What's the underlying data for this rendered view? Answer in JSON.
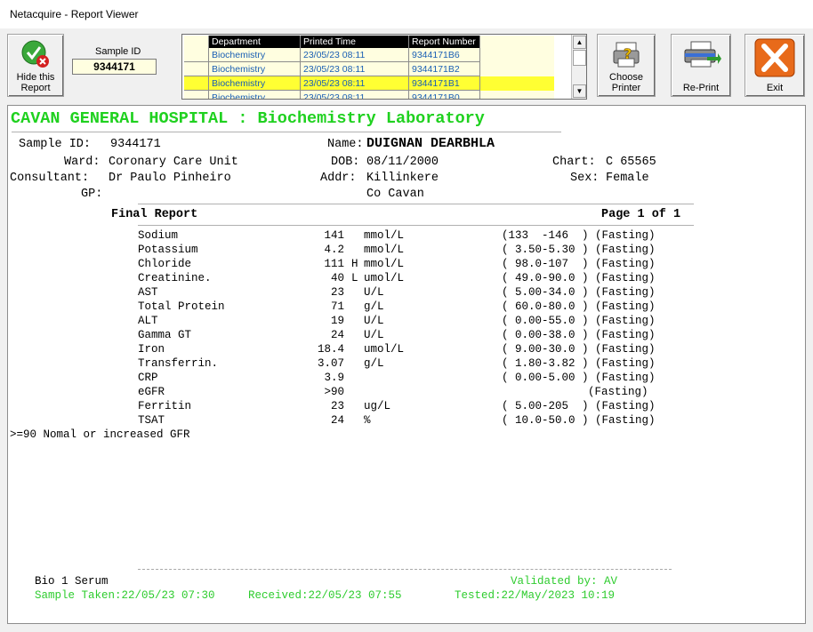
{
  "window": {
    "title": "Netacquire - Report Viewer"
  },
  "toolbar": {
    "hide_label_1": "Hide this",
    "hide_label_2": "Report",
    "sample_id_label": "Sample ID",
    "sample_id_value": "9344171",
    "choose_printer_1": "Choose",
    "choose_printer_2": "Printer",
    "reprint": "Re-Print",
    "exit": "Exit"
  },
  "grid": {
    "headers": [
      "Department",
      "Printed Time",
      "Report Number"
    ],
    "rows": [
      {
        "department": "Biochemistry",
        "printed": "23/05/23 08:11",
        "report": "9344171B6"
      },
      {
        "department": "Biochemistry",
        "printed": "23/05/23 08:11",
        "report": "9344171B2"
      },
      {
        "department": "Biochemistry",
        "printed": "23/05/23 08:11",
        "report": "9344171B1"
      },
      {
        "department": "Biochemistry",
        "printed": "23/05/23 08:11",
        "report": "9344171B0"
      }
    ]
  },
  "report": {
    "hospital": "CAVAN GENERAL HOSPITAL : Biochemistry Laboratory",
    "sample_id_label": "Sample ID:",
    "sample_id": "9344171",
    "name_label": "Name:",
    "name": "DUIGNAN DEARBHLA",
    "ward_label": "Ward:",
    "ward": "Coronary Care Unit",
    "dob_label": "DOB:",
    "dob": "08/11/2000",
    "chart_label": "Chart:",
    "chart": "C 65565",
    "consultant_label": "Consultant:",
    "consultant": "Dr Paulo Pinheiro",
    "addr_label": "Addr:",
    "addr1": "Killinkere",
    "addr2": "Co Cavan",
    "sex_label": "Sex:",
    "sex": "Female",
    "gp_label": "GP:",
    "final_report": "Final Report",
    "page": "Page 1 of 1",
    "results": [
      {
        "test": "Sodium",
        "value": "141",
        "flag": "",
        "unit": "mmol/L",
        "range": "(133  -146  )",
        "note": "(Fasting)"
      },
      {
        "test": "Potassium",
        "value": "4.2",
        "flag": "",
        "unit": "mmol/L",
        "range": "( 3.50-5.30 )",
        "note": "(Fasting)"
      },
      {
        "test": "Chloride",
        "value": "111",
        "flag": "H",
        "unit": "mmol/L",
        "range": "( 98.0-107  )",
        "note": "(Fasting)"
      },
      {
        "test": "Creatinine.",
        "value": "40",
        "flag": "L",
        "unit": "umol/L",
        "range": "( 49.0-90.0 )",
        "note": "(Fasting)"
      },
      {
        "test": "AST",
        "value": "23",
        "flag": "",
        "unit": "U/L",
        "range": "( 5.00-34.0 )",
        "note": "(Fasting)"
      },
      {
        "test": "Total Protein",
        "value": "71",
        "flag": "",
        "unit": "g/L",
        "range": "( 60.0-80.0 )",
        "note": "(Fasting)"
      },
      {
        "test": "ALT",
        "value": "19",
        "flag": "",
        "unit": "U/L",
        "range": "( 0.00-55.0 )",
        "note": "(Fasting)"
      },
      {
        "test": "Gamma GT",
        "value": "24",
        "flag": "",
        "unit": "U/L",
        "range": "( 0.00-38.0 )",
        "note": "(Fasting)"
      },
      {
        "test": "Iron",
        "value": "18.4",
        "flag": "",
        "unit": "umol/L",
        "range": "( 9.00-30.0 )",
        "note": "(Fasting)"
      },
      {
        "test": "Transferrin.",
        "value": "3.07",
        "flag": "",
        "unit": "g/L",
        "range": "( 1.80-3.82 )",
        "note": "(Fasting)"
      },
      {
        "test": "CRP",
        "value": "3.9",
        "flag": "",
        "unit": "",
        "range": "( 0.00-5.00 )",
        "note": "(Fasting)"
      },
      {
        "test": "eGFR",
        "value": ">90",
        "flag": "",
        "unit": "",
        "range": "",
        "note": "(Fasting)"
      },
      {
        "test": "Ferritin",
        "value": "23",
        "flag": "",
        "unit": "ug/L",
        "range": "( 5.00-205  )",
        "note": "(Fasting)"
      },
      {
        "test": "TSAT",
        "value": "24",
        "flag": "",
        "unit": "%",
        "range": "( 10.0-50.0 )",
        "note": "(Fasting)"
      }
    ],
    "comment": ">=90 Nomal or increased GFR",
    "specimen": "Bio 1 Serum",
    "validated": "Validated by: AV",
    "sample_taken": "Sample Taken:22/05/23 07:30",
    "received": "Received:22/05/23 07:55",
    "tested": "Tested:22/May/2023 10:19"
  },
  "colors": {
    "selected_row": "#ffff33",
    "row_bg": "#fffee0",
    "hospital_text": "#1fd11f",
    "link_text": "#1a5fb4"
  }
}
